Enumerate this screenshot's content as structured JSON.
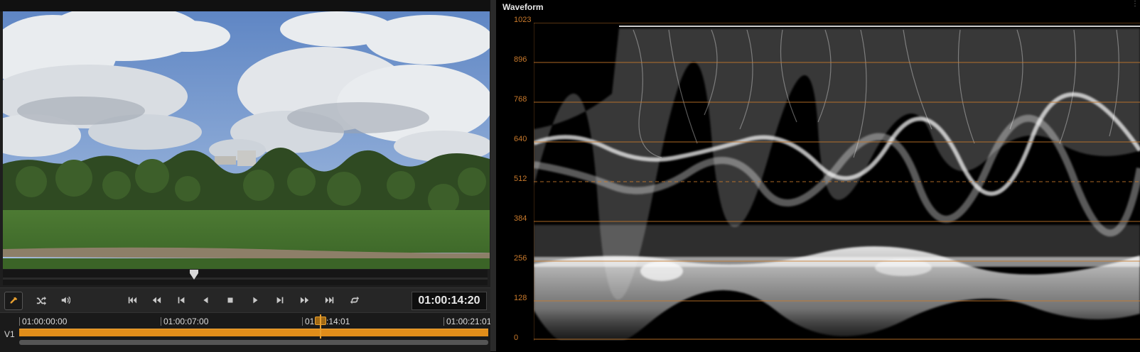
{
  "viewer": {
    "timecode": "01:00:14:20",
    "playhead_fraction": 0.395
  },
  "transport": {
    "buttons": [
      {
        "name": "eyedropper-icon"
      },
      {
        "name": "shuffle-icon"
      },
      {
        "name": "speaker-icon"
      },
      {
        "name": "skip-to-start-icon"
      },
      {
        "name": "fast-reverse-icon"
      },
      {
        "name": "previous-frame-icon"
      },
      {
        "name": "play-reverse-icon"
      },
      {
        "name": "stop-icon"
      },
      {
        "name": "play-icon"
      },
      {
        "name": "next-frame-icon"
      },
      {
        "name": "fast-forward-icon"
      },
      {
        "name": "skip-to-end-icon"
      },
      {
        "name": "loop-icon"
      }
    ]
  },
  "timeline": {
    "track": "V1",
    "ruler": [
      "01:00:00:00",
      "01:00:07:00",
      "01:00:14:01",
      "01:00:21:01"
    ]
  },
  "scope": {
    "title": "Waveform",
    "scale": [
      "1023",
      "896",
      "768",
      "640",
      "512",
      "384",
      "256",
      "128",
      "0"
    ],
    "accent_color": "#c97a2c"
  }
}
